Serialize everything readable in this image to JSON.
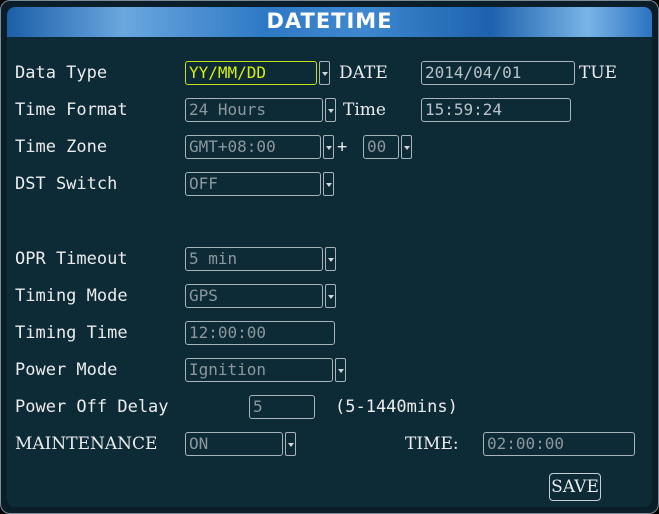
{
  "window": {
    "title": "DATETIME"
  },
  "fields": {
    "data_type": {
      "label": "Data Type",
      "value": "YY/MM/DD"
    },
    "date": {
      "label": "DATE",
      "value": "2014/04/01",
      "weekday": "TUE"
    },
    "time_format": {
      "label": "Time Format",
      "value": "24 Hours"
    },
    "time": {
      "label": "Time",
      "value": "15:59:24"
    },
    "time_zone": {
      "label": "Time Zone",
      "value": "GMT+08:00",
      "sign": "+",
      "minutes": "00"
    },
    "dst_switch": {
      "label": "DST Switch",
      "value": "OFF"
    },
    "opr_timeout": {
      "label": "OPR Timeout",
      "value": "5 min"
    },
    "timing_mode": {
      "label": "Timing Mode",
      "value": "GPS"
    },
    "timing_time": {
      "label": "Timing Time",
      "value": "12:00:00"
    },
    "power_mode": {
      "label": "Power Mode",
      "value": "Ignition"
    },
    "power_off_delay": {
      "label": "Power Off Delay",
      "value": "5",
      "hint": "(5-1440mins)"
    },
    "maintenance": {
      "label": "MAINTENANCE",
      "value": "ON",
      "time_label": "TIME:",
      "time_value": "02:00:00"
    }
  },
  "buttons": {
    "save_label": "SAVE"
  },
  "colors": {
    "title_bar": "#2e79c5",
    "panel_background": "#0d2a37",
    "focus_highlight": "#d8f000",
    "label_text": "#ececec",
    "field_text": "#8c979e"
  },
  "icons": {
    "dropdown": "chevron-down-icon"
  }
}
